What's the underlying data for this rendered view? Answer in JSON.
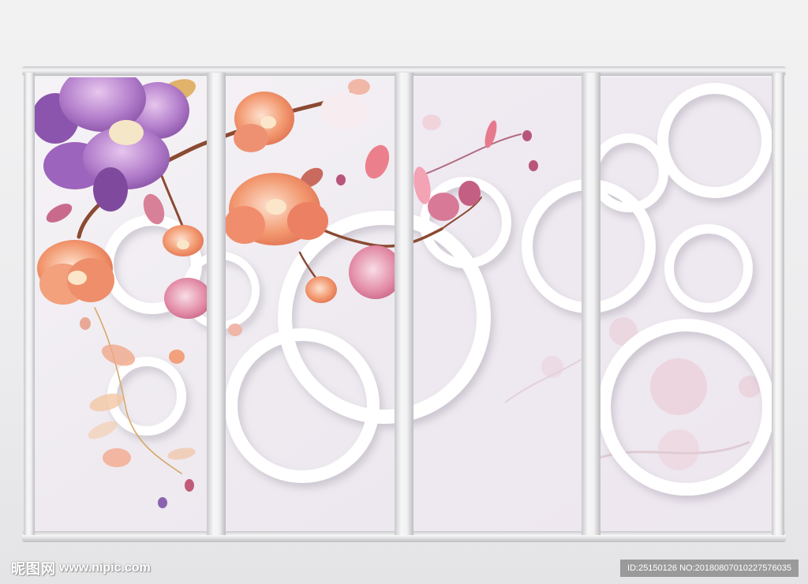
{
  "watermark": {
    "site_name": "昵图网",
    "site_url": "www.nipic.com",
    "image_id": "ID:25150126 NO:20180807010227576035"
  },
  "colors": {
    "frame": "#e9e9eb",
    "panel_bg": "#f1ecf2",
    "ring": "#ffffff",
    "petal_purple": "#a46dc0",
    "petal_coral": "#ef8a6a",
    "petal_pink": "#dc7390",
    "branch": "#8b4a32"
  },
  "panels_count": 4
}
